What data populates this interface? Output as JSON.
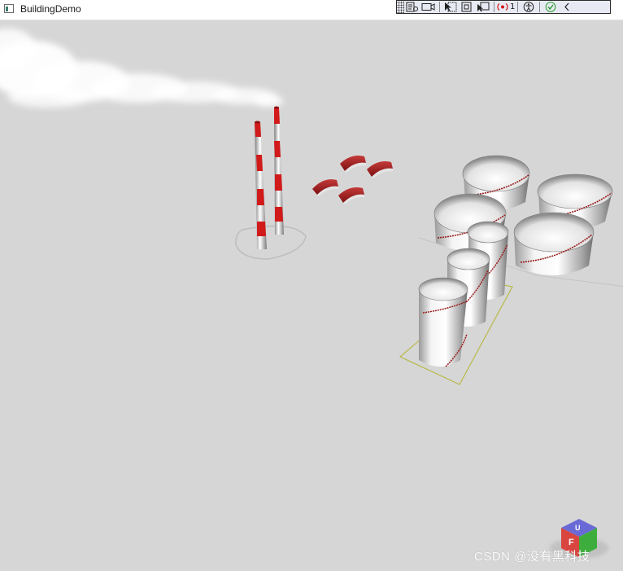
{
  "window": {
    "title": "BuildingDemo",
    "icon": "app-window-icon"
  },
  "debug_toolbar": {
    "tools": [
      {
        "name": "visual-tree-icon"
      },
      {
        "name": "camera-icon"
      },
      {
        "name": "select-element-icon"
      },
      {
        "name": "display-layout-adorners-icon"
      },
      {
        "name": "track-focus-icon"
      },
      {
        "name": "binding-failures-icon"
      },
      {
        "name": "accessibility-icon"
      },
      {
        "name": "checkmark-icon"
      },
      {
        "name": "collapse-chevron-icon"
      }
    ],
    "binding_failure_count": "1"
  },
  "scene": {
    "background": "#d6d6d6",
    "chimney_stripe_color": "#d11a1a",
    "tank_color": "#e6e6e6",
    "selection_color": "#b9b94a",
    "objects": [
      "smoke-plume",
      "chimney-left",
      "chimney-right",
      "rooftops",
      "storage-tanks",
      "view-cube"
    ]
  },
  "view_cube": {
    "faces": [
      "F",
      "U"
    ]
  },
  "watermark": {
    "text": "CSDN @没有黑科技"
  }
}
